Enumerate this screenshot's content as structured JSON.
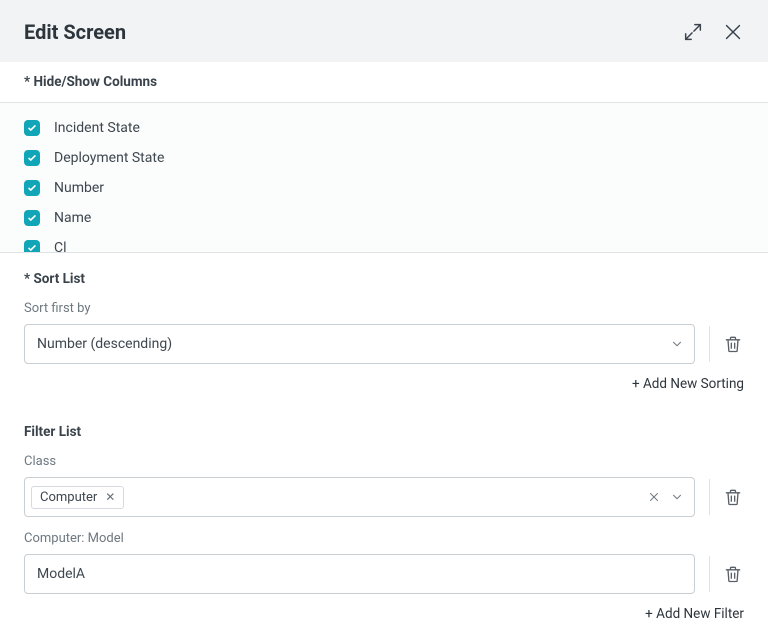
{
  "colors": {
    "accent": "#10a6b7"
  },
  "header": {
    "title": "Edit Screen"
  },
  "columns": {
    "heading": "* Hide/Show Columns",
    "items": [
      {
        "label": "Incident State",
        "checked": true
      },
      {
        "label": "Deployment State",
        "checked": true
      },
      {
        "label": "Number",
        "checked": true
      },
      {
        "label": "Name",
        "checked": true
      },
      {
        "label": "Cl",
        "checked": true
      }
    ]
  },
  "sort": {
    "heading": "* Sort List",
    "first_label": "Sort first by",
    "first_value": "Number (descending)",
    "add_label": "+ Add New Sorting"
  },
  "filter": {
    "heading": "Filter List",
    "class_label": "Class",
    "class_chip": "Computer",
    "model_label": "Computer: Model",
    "model_value": "ModelA",
    "add_label": "+ Add New Filter"
  }
}
